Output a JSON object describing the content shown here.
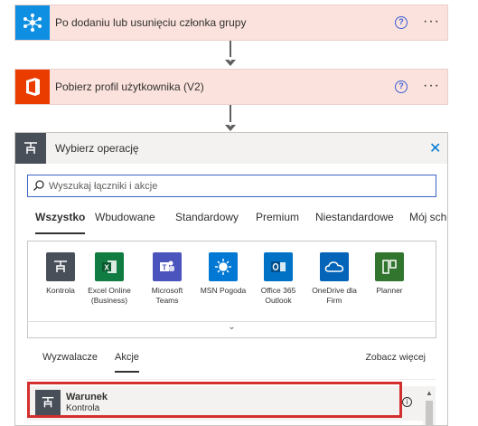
{
  "trigger_card": {
    "title": "Po dodaniu lub usunięciu członka grupy",
    "help": "?",
    "more": "···"
  },
  "action_card": {
    "title": "Pobierz profil użytkownika (V2)",
    "help": "?",
    "more": "···"
  },
  "panel": {
    "title": "Wybierz operację",
    "close": "✕",
    "search_placeholder": "Wyszukaj łączniki i akcje",
    "tabs": [
      "Wszystko",
      "Wbudowane",
      "Standardowy",
      "Premium",
      "Niestandardowe",
      "Mój schowek"
    ],
    "connectors": [
      {
        "name": "Kontrola",
        "color": "#484f58",
        "icon": "control-icon"
      },
      {
        "name": "Excel Online (Business)",
        "color": "#107c41",
        "icon": "excel-icon"
      },
      {
        "name": "Microsoft Teams",
        "color": "#4b53bc",
        "icon": "teams-icon"
      },
      {
        "name": "MSN Pogoda",
        "color": "#0078d4",
        "icon": "weather-icon"
      },
      {
        "name": "Office 365 Outlook",
        "color": "#0072c6",
        "icon": "outlook-icon"
      },
      {
        "name": "OneDrive dla Firm",
        "color": "#0364b8",
        "icon": "onedrive-icon"
      },
      {
        "name": "Planner",
        "color": "#31752f",
        "icon": "planner-icon"
      }
    ],
    "expand": "⌄",
    "subtabs": [
      "Wyzwalacze",
      "Akcje"
    ],
    "see_more": "Zobacz więcej",
    "result": {
      "name": "Warunek",
      "connector": "Kontrola",
      "info": "i"
    }
  },
  "colors": {
    "card_bg": "#fbe2dc",
    "accent": "#0078d4",
    "highlight": "#d32f2f"
  }
}
